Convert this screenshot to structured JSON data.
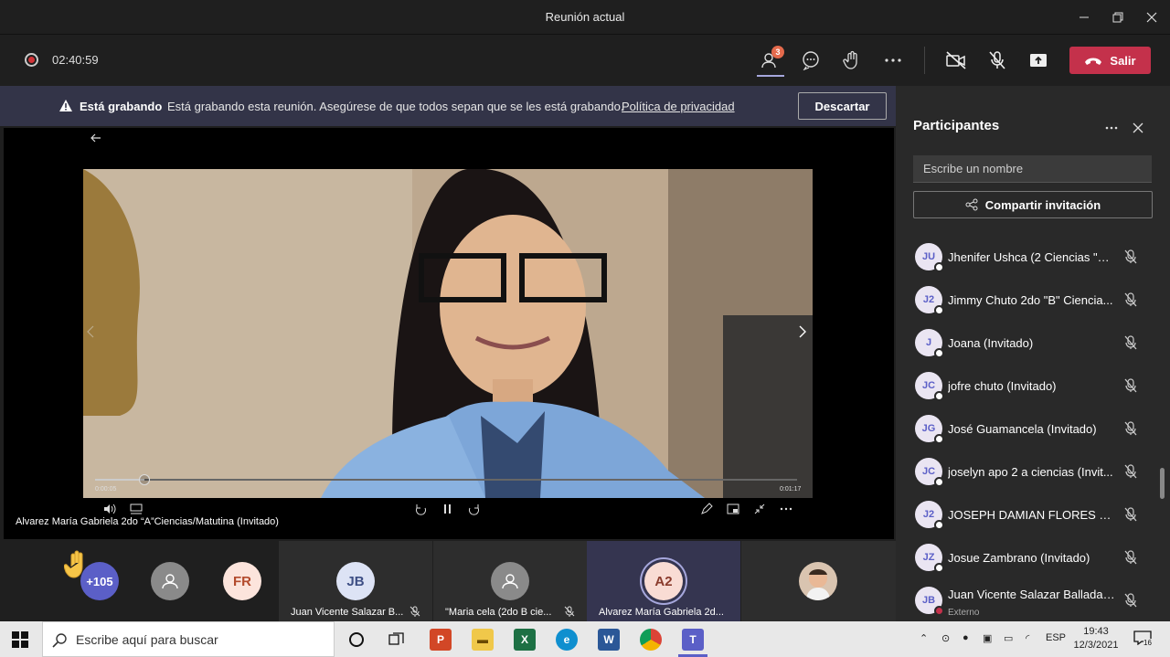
{
  "window": {
    "title": "Reunión actual"
  },
  "toolbar": {
    "timer": "02:40:59",
    "participants_badge": "3",
    "leave_label": "Salir"
  },
  "banner": {
    "bold": "Está grabando",
    "message": "Está grabando esta reunión. Asegúrese de que todos sepan que se les está grabando.",
    "link": "Política de privacidad",
    "dismiss": "Descartar"
  },
  "stage": {
    "caption": "Alvarez María Gabriela 2do “A”Ciencias/Matutina (Invitado)",
    "time_current": "0:00:05",
    "time_total": "0:01:17",
    "progress": 0.07
  },
  "strip": {
    "raised_hand_count": "+105",
    "fr_initials": "FR",
    "jb_initials": "JB",
    "jb_name": "Juan Vicente Salazar B...",
    "maria_name": "\"Maria cela (2do B cie...",
    "a2_initials": "A2",
    "a2_name": "Alvarez María Gabriela 2d..."
  },
  "panel": {
    "title": "Participantes",
    "search_placeholder": "Escribe un nombre",
    "share_label": "Compartir invitación",
    "participants": [
      {
        "initials": "JU",
        "name": "Jhenifer Ushca (2 Ciencias \"A ...",
        "sub": ""
      },
      {
        "initials": "J2",
        "name": "Jimmy Chuto 2do \"B\" Ciencia...",
        "sub": ""
      },
      {
        "initials": "J",
        "name": "Joana (Invitado)",
        "sub": ""
      },
      {
        "initials": "JC",
        "name": "jofre chuto (Invitado)",
        "sub": ""
      },
      {
        "initials": "JG",
        "name": "José Guamancela (Invitado)",
        "sub": ""
      },
      {
        "initials": "JC",
        "name": "joselyn apo 2 a ciencias (Invit...",
        "sub": ""
      },
      {
        "initials": "J2",
        "name": "JOSEPH DAMIAN FLORES DE ...",
        "sub": ""
      },
      {
        "initials": "JZ",
        "name": "Josue Zambrano (Invitado)",
        "sub": ""
      },
      {
        "initials": "JB",
        "name": "Juan Vicente Salazar Balladares",
        "sub": "Externo"
      }
    ]
  },
  "taskbar": {
    "search_placeholder": "Escribe aquí para buscar",
    "lang": "ESP",
    "time": "19:43",
    "date": "12/3/2021",
    "notifications": "16"
  },
  "colors": {
    "accent": "#a6a7dc",
    "leave": "#c4314b",
    "banner": "#333448",
    "panel": "#292929"
  }
}
